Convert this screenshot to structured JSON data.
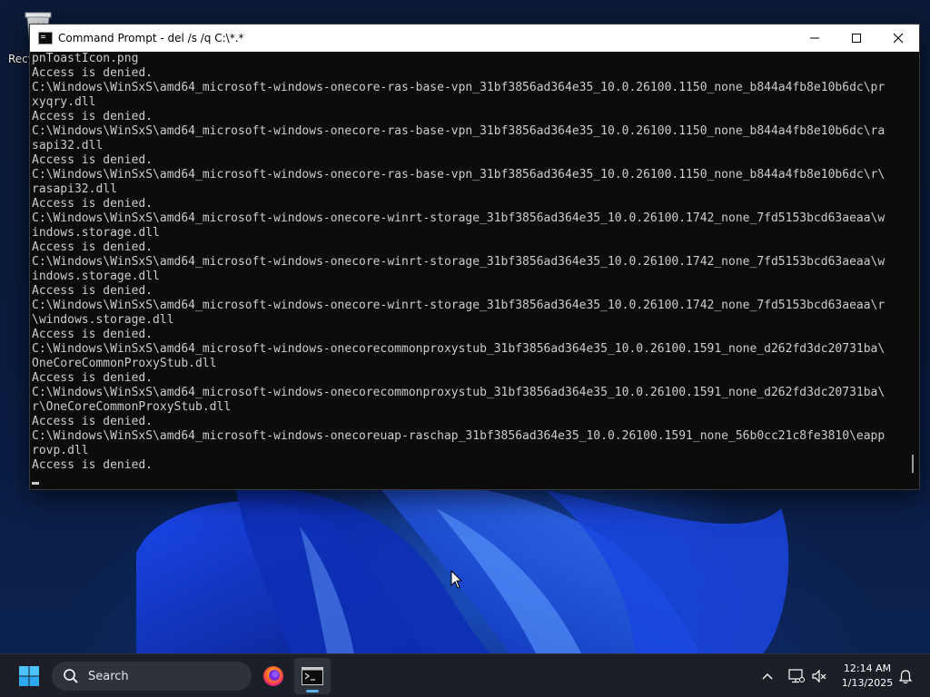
{
  "desktop": {
    "icons": [
      {
        "label": "Recycle Bin",
        "icon": "recycle-bin-icon"
      }
    ]
  },
  "window": {
    "title": "Command Prompt - del  /s /q C:\\*.*",
    "icon": "command-prompt-icon",
    "controls": {
      "minimize": "minimize-icon",
      "maximize": "maximize-icon",
      "close": "close-icon"
    },
    "console": {
      "lines": [
        "pnToastIcon.png",
        "Access is denied.",
        "C:\\Windows\\WinSxS\\amd64_microsoft-windows-onecore-ras-base-vpn_31bf3856ad364e35_10.0.26100.1150_none_b844a4fb8e10b6dc\\pr",
        "xyqry.dll",
        "Access is denied.",
        "C:\\Windows\\WinSxS\\amd64_microsoft-windows-onecore-ras-base-vpn_31bf3856ad364e35_10.0.26100.1150_none_b844a4fb8e10b6dc\\ra",
        "sapi32.dll",
        "Access is denied.",
        "C:\\Windows\\WinSxS\\amd64_microsoft-windows-onecore-ras-base-vpn_31bf3856ad364e35_10.0.26100.1150_none_b844a4fb8e10b6dc\\r\\",
        "rasapi32.dll",
        "Access is denied.",
        "C:\\Windows\\WinSxS\\amd64_microsoft-windows-onecore-winrt-storage_31bf3856ad364e35_10.0.26100.1742_none_7fd5153bcd63aeaa\\w",
        "indows.storage.dll",
        "Access is denied.",
        "C:\\Windows\\WinSxS\\amd64_microsoft-windows-onecore-winrt-storage_31bf3856ad364e35_10.0.26100.1742_none_7fd5153bcd63aeaa\\w",
        "indows.storage.dll",
        "Access is denied.",
        "C:\\Windows\\WinSxS\\amd64_microsoft-windows-onecore-winrt-storage_31bf3856ad364e35_10.0.26100.1742_none_7fd5153bcd63aeaa\\r",
        "\\windows.storage.dll",
        "Access is denied.",
        "C:\\Windows\\WinSxS\\amd64_microsoft-windows-onecorecommonproxystub_31bf3856ad364e35_10.0.26100.1591_none_d262fd3dc20731ba\\",
        "OneCoreCommonProxyStub.dll",
        "Access is denied.",
        "C:\\Windows\\WinSxS\\amd64_microsoft-windows-onecorecommonproxystub_31bf3856ad364e35_10.0.26100.1591_none_d262fd3dc20731ba\\",
        "r\\OneCoreCommonProxyStub.dll",
        "Access is denied.",
        "C:\\Windows\\WinSxS\\amd64_microsoft-windows-onecoreuap-raschap_31bf3856ad364e35_10.0.26100.1591_none_56b0cc21c8fe3810\\eapp",
        "rovp.dll",
        "Access is denied."
      ]
    }
  },
  "taskbar": {
    "start_icon": "windows-start-icon",
    "search": {
      "placeholder": "Search",
      "icon": "search-icon"
    },
    "apps": [
      {
        "name": "Firefox",
        "icon": "firefox-icon",
        "active": false
      },
      {
        "name": "Command Prompt",
        "icon": "terminal-icon",
        "active": true
      }
    ],
    "tray": {
      "icons": [
        "chevron-up-icon",
        "network-icon",
        "volume-muted-icon",
        "notification-bell-icon"
      ],
      "time": "12:14 AM",
      "date": "1/13/2025"
    }
  },
  "colors": {
    "console_bg": "#0c0c0c",
    "console_text": "#cccccc",
    "titlebar_bg": "#ffffff",
    "taskbar_bg": "#1c1f26",
    "accent": "#5fb3ef"
  }
}
